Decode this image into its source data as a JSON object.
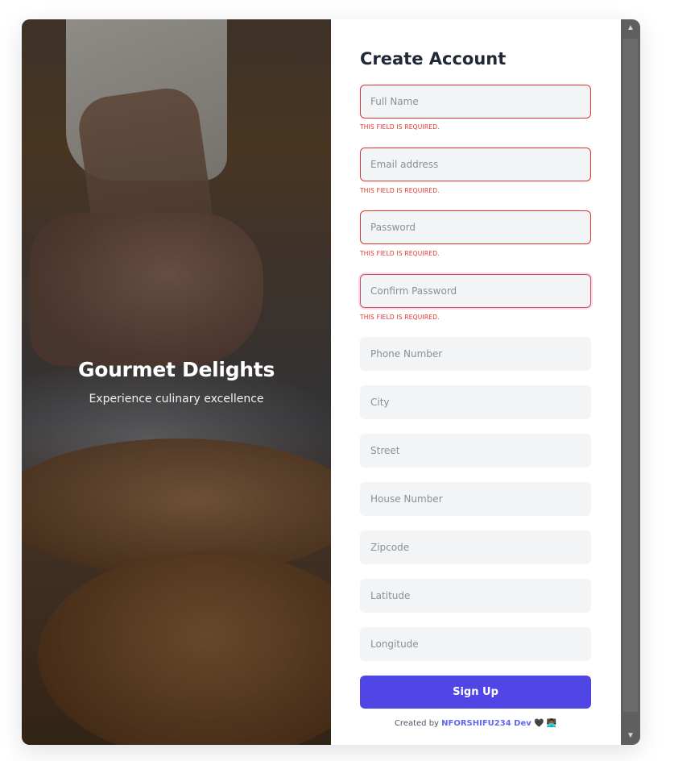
{
  "hero": {
    "title": "Gourmet Delights",
    "subtitle": "Experience culinary excellence"
  },
  "form": {
    "title": "Create Account",
    "fields": {
      "full_name": {
        "placeholder": "Full Name",
        "value": "",
        "error": "THIS FIELD IS REQUIRED."
      },
      "email": {
        "placeholder": "Email address",
        "value": "",
        "error": "THIS FIELD IS REQUIRED."
      },
      "password": {
        "placeholder": "Password",
        "value": "",
        "error": "THIS FIELD IS REQUIRED."
      },
      "confirm_password": {
        "placeholder": "Confirm Password",
        "value": "",
        "error": "THIS FIELD IS REQUIRED."
      },
      "phone": {
        "placeholder": "Phone Number",
        "value": ""
      },
      "city": {
        "placeholder": "City",
        "value": ""
      },
      "street": {
        "placeholder": "Street",
        "value": ""
      },
      "house_number": {
        "placeholder": "House Number",
        "value": ""
      },
      "zipcode": {
        "placeholder": "Zipcode",
        "value": ""
      },
      "latitude": {
        "placeholder": "Latitude",
        "value": ""
      },
      "longitude": {
        "placeholder": "Longitude",
        "value": ""
      }
    },
    "submit_label": "Sign Up",
    "credit": {
      "prefix": "Created by",
      "author": "NFORSHIFU234 Dev",
      "heart": "🖤",
      "emoji": "👨🏾‍💻"
    }
  },
  "colors": {
    "accent": "#4f46e5",
    "error": "#e3342f",
    "input_bg": "#f3f4f6",
    "title": "#1f2937"
  },
  "icons": {
    "scroll_up": "triangle-up-icon",
    "scroll_down": "triangle-down-icon"
  }
}
